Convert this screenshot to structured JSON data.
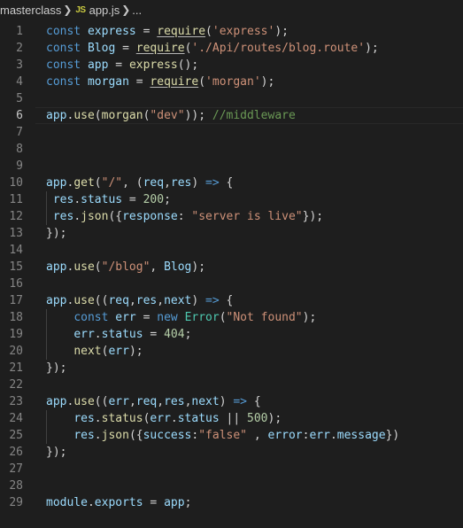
{
  "breadcrumb": {
    "folder": "masterclass",
    "file_icon": "JS",
    "file": "app.js",
    "more": "..."
  },
  "colors": {
    "background": "#1e1e1e",
    "keyword": "#569cd6",
    "variable": "#9cdcfe",
    "function": "#dcdcaa",
    "string": "#ce9178",
    "number": "#b5cea8",
    "class": "#4ec9b0",
    "comment": "#6a9955",
    "line_number": "#858585"
  },
  "editor": {
    "current_line": 6,
    "lines": [
      "const express = require('express');",
      "const Blog = require('./Api/routes/blog.route');",
      "const app = express();",
      "const morgan = require('morgan');",
      "",
      "app.use(morgan(\"dev\")); //middleware",
      "",
      "",
      "",
      "app.get(\"/\", (req,res) => {",
      " res.status = 200;",
      " res.json({response: \"server is live\"});",
      "});",
      "",
      "app.use(\"/blog\", Blog);",
      "",
      "app.use((req,res,next) => {",
      "    const err = new Error(\"Not found\");",
      "    err.status = 404;",
      "    next(err);",
      "});",
      "",
      "app.use((err,req,res,next) => {",
      "    res.status(err.status || 500);",
      "    res.json({success:\"false\" , error:err.message})",
      "});",
      "",
      "",
      "module.exports = app;"
    ]
  }
}
